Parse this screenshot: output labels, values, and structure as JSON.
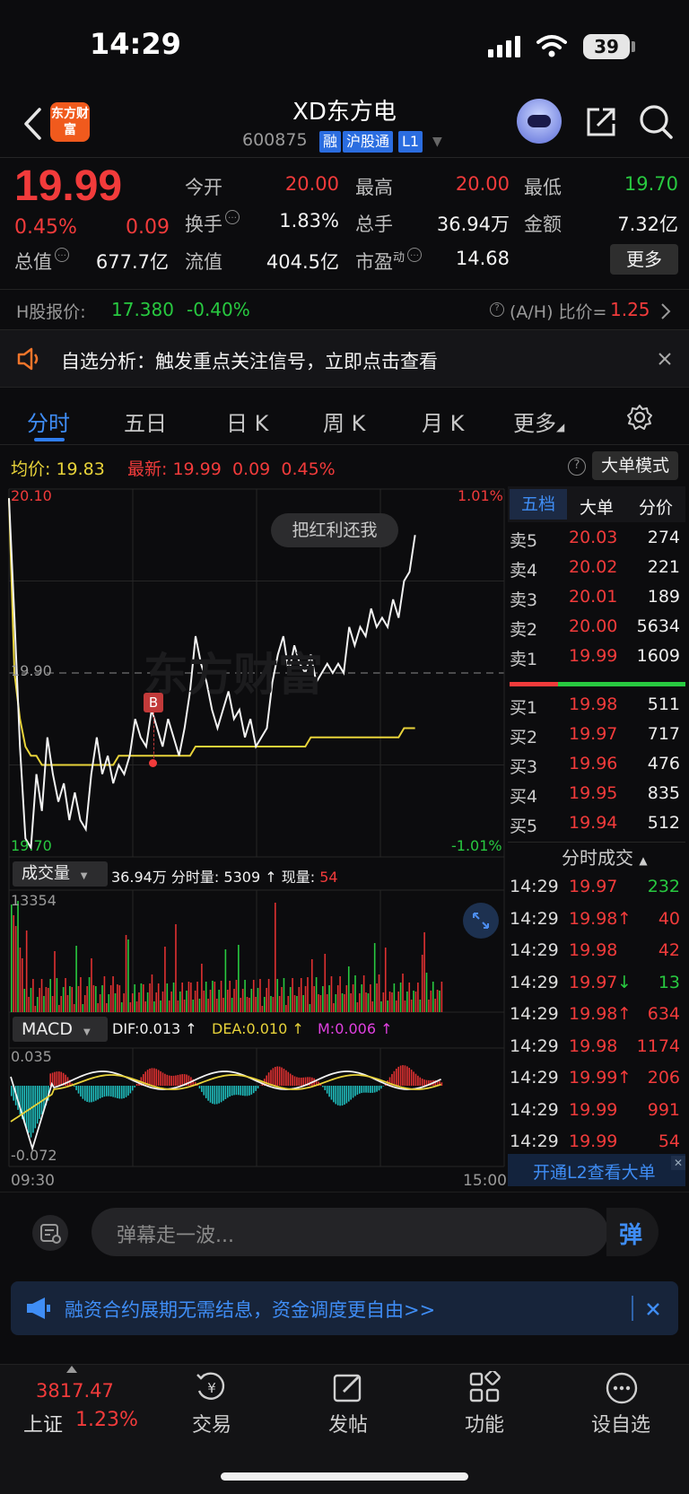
{
  "status_bar": {
    "time": "14:29",
    "battery": "39"
  },
  "header": {
    "logo": "东方财富",
    "stock_name": "XD东方电",
    "stock_code": "600875",
    "tags": [
      "融",
      "沪股通",
      "L1"
    ]
  },
  "quote": {
    "price": "19.99",
    "change_pct": "0.45%",
    "change": "0.09",
    "open_label": "今开",
    "open": "20.00",
    "high_label": "最高",
    "high": "20.00",
    "low_label": "最低",
    "low": "19.70",
    "turnover_label": "换手",
    "turnover": "1.83%",
    "volume_label": "总手",
    "volume": "36.94万",
    "amount_label": "金额",
    "amount": "7.32亿",
    "mktcap_label": "总值",
    "mktcap": "677.7亿",
    "float_label": "流值",
    "float": "404.5亿",
    "pe_label": "市盈",
    "pe_sup": "动",
    "pe": "14.68",
    "more_button": "更多"
  },
  "h_share": {
    "label": "H股报价:",
    "price": "17.380",
    "change": "-0.40%",
    "ah_label": "(A/H) 比价=",
    "ah_value": "1.25"
  },
  "notice": {
    "text": "自选分析：触发重点关注信号，立即点击查看"
  },
  "tabs": [
    "分时",
    "五日",
    "日 K",
    "周 K",
    "月 K",
    "更多"
  ],
  "avg_row": {
    "avg_label": "均价:",
    "avg": "19.83",
    "last_label": "最新:",
    "last": "19.99",
    "chg": "0.09",
    "pct": "0.45%",
    "big_mode": "大单模式"
  },
  "chart_labels": {
    "top_price": "20.10",
    "top_pct": "1.01%",
    "mid_price": "19.90",
    "bottom_price": "19.70",
    "bottom_pct": "-1.01%",
    "bubble": "把红利还我",
    "watermark": "东方财富",
    "marker": "B",
    "vol_selector": "成交量",
    "vol_total": "36.94万",
    "vol_minute_label": "分时量:",
    "vol_minute": "5309",
    "vol_now_label": "现量:",
    "vol_now": "54",
    "vol_max": "13354",
    "macd_selector": "MACD",
    "dif": "DIF:0.013 ↑",
    "dea": "DEA:0.010 ↑",
    "m": "M:0.006 ↑",
    "macd_max": "0.035",
    "macd_min": "-0.072",
    "time_start": "09:30",
    "time_end": "15:00"
  },
  "chart_data": {
    "type": "line",
    "ylim": [
      19.7,
      20.1
    ],
    "price": [
      20.09,
      19.96,
      19.82,
      19.72,
      19.71,
      19.79,
      19.75,
      19.83,
      19.79,
      19.76,
      19.78,
      19.74,
      19.77,
      19.74,
      19.73,
      19.79,
      19.83,
      19.79,
      19.81,
      19.78,
      19.8,
      19.79,
      19.81,
      19.85,
      19.83,
      19.82,
      19.86,
      19.84,
      19.82,
      19.85,
      19.83,
      19.81,
      19.84,
      19.88,
      19.94,
      19.91,
      19.89,
      19.86,
      19.84,
      19.86,
      19.88,
      19.85,
      19.86,
      19.83,
      19.85,
      19.82,
      19.83,
      19.84,
      19.89,
      19.92,
      19.94,
      19.9,
      19.93,
      19.91,
      19.9,
      19.92,
      19.89,
      19.9,
      19.91,
      19.9,
      19.91,
      19.9,
      19.95,
      19.93,
      19.95,
      19.94,
      19.97,
      19.95,
      19.96,
      19.95,
      19.98,
      19.96,
      20.0,
      20.01,
      20.05
    ],
    "avg": [
      20.09,
      19.9,
      19.85,
      19.82,
      19.81,
      19.81,
      19.8,
      19.8,
      19.8,
      19.8,
      19.8,
      19.8,
      19.8,
      19.8,
      19.8,
      19.8,
      19.8,
      19.8,
      19.8,
      19.8,
      19.81,
      19.81,
      19.81,
      19.81,
      19.81,
      19.81,
      19.81,
      19.81,
      19.81,
      19.81,
      19.81,
      19.81,
      19.81,
      19.81,
      19.82,
      19.82,
      19.82,
      19.82,
      19.82,
      19.82,
      19.82,
      19.82,
      19.82,
      19.82,
      19.82,
      19.82,
      19.82,
      19.82,
      19.82,
      19.82,
      19.82,
      19.82,
      19.82,
      19.82,
      19.82,
      19.83,
      19.83,
      19.83,
      19.83,
      19.83,
      19.83,
      19.83,
      19.83,
      19.83,
      19.83,
      19.83,
      19.83,
      19.83,
      19.83,
      19.83,
      19.83,
      19.83,
      19.84,
      19.84,
      19.84
    ]
  },
  "order_book": {
    "tabs": [
      "五档",
      "大单",
      "分价"
    ],
    "asks": [
      {
        "label": "卖5",
        "price": "20.03",
        "vol": "274"
      },
      {
        "label": "卖4",
        "price": "20.02",
        "vol": "221"
      },
      {
        "label": "卖3",
        "price": "20.01",
        "vol": "189"
      },
      {
        "label": "卖2",
        "price": "20.00",
        "vol": "5634"
      },
      {
        "label": "卖1",
        "price": "19.99",
        "vol": "1609"
      }
    ],
    "bids": [
      {
        "label": "买1",
        "price": "19.98",
        "vol": "511"
      },
      {
        "label": "买2",
        "price": "19.97",
        "vol": "717"
      },
      {
        "label": "买3",
        "price": "19.96",
        "vol": "476"
      },
      {
        "label": "买4",
        "price": "19.95",
        "vol": "835"
      },
      {
        "label": "买5",
        "price": "19.94",
        "vol": "512"
      }
    ],
    "ticks_title": "分时成交",
    "ticks": [
      {
        "time": "14:29",
        "price": "19.97",
        "arrow": "",
        "vol": "232",
        "dir": "green"
      },
      {
        "time": "14:29",
        "price": "19.98",
        "arrow": "↑",
        "vol": "40",
        "dir": "red"
      },
      {
        "time": "14:29",
        "price": "19.98",
        "arrow": "",
        "vol": "42",
        "dir": "red"
      },
      {
        "time": "14:29",
        "price": "19.97",
        "arrow": "↓",
        "vol": "13",
        "dir": "green"
      },
      {
        "time": "14:29",
        "price": "19.98",
        "arrow": "↑",
        "vol": "634",
        "dir": "red"
      },
      {
        "time": "14:29",
        "price": "19.98",
        "arrow": "",
        "vol": "1174",
        "dir": "red"
      },
      {
        "time": "14:29",
        "price": "19.99",
        "arrow": "↑",
        "vol": "206",
        "dir": "red"
      },
      {
        "time": "14:29",
        "price": "19.99",
        "arrow": "",
        "vol": "991",
        "dir": "red"
      },
      {
        "time": "14:29",
        "price": "19.99",
        "arrow": "",
        "vol": "54",
        "dir": "red"
      }
    ],
    "l2_banner": "开通L2查看大单"
  },
  "comment": {
    "placeholder": "弹幕走一波...",
    "danmu": "弹"
  },
  "promo": {
    "text": "融资合约展期无需结息，资金调度更自由>>"
  },
  "bottom_nav": {
    "index_value": "3817.47",
    "index_name": "上证",
    "index_pct": "1.23%",
    "items": [
      "交易",
      "发帖",
      "功能",
      "设自选"
    ]
  }
}
